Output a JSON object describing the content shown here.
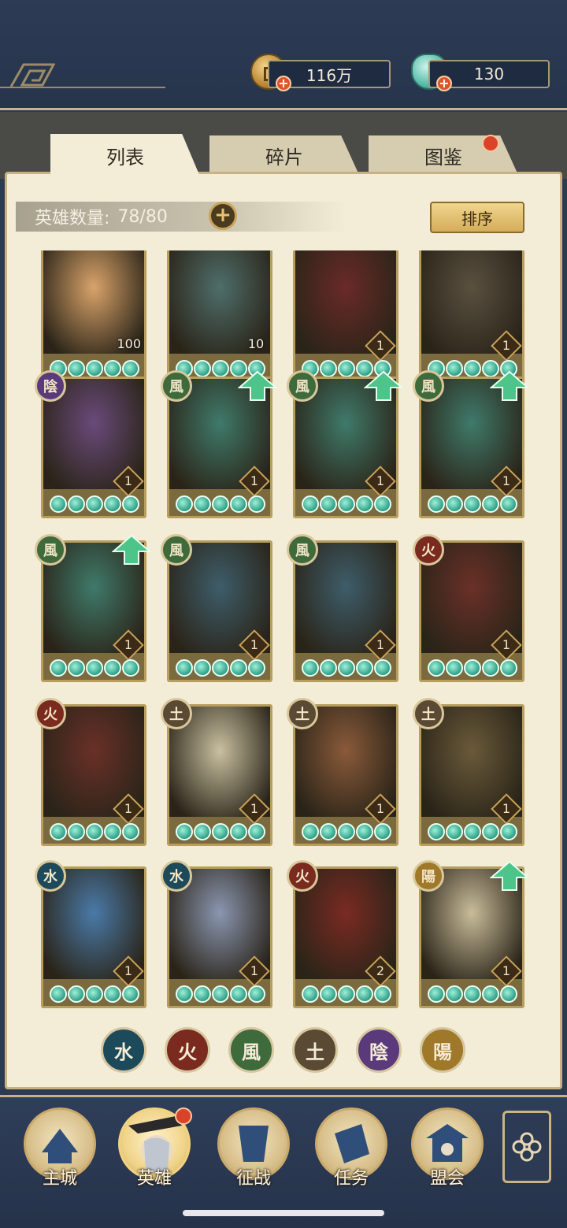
{
  "currency": {
    "coins": "116万",
    "gems": "130"
  },
  "tabs": [
    {
      "label": "列表"
    },
    {
      "label": "碎片"
    },
    {
      "label": "图鉴"
    }
  ],
  "hero_count": {
    "label": "英雄数量:",
    "value": "78/80"
  },
  "sort_label": "排序",
  "heroes": [
    {
      "level": "100",
      "element": "",
      "upgrade": false
    },
    {
      "level": "10",
      "element": "",
      "upgrade": false
    },
    {
      "level": "1",
      "element": "",
      "upgrade": false
    },
    {
      "level": "1",
      "element": "",
      "upgrade": false
    },
    {
      "level": "1",
      "element": "陰",
      "upgrade": false
    },
    {
      "level": "1",
      "element": "風",
      "upgrade": true
    },
    {
      "level": "1",
      "element": "風",
      "upgrade": true
    },
    {
      "level": "1",
      "element": "風",
      "upgrade": true
    },
    {
      "level": "1",
      "element": "風",
      "upgrade": true
    },
    {
      "level": "1",
      "element": "風",
      "upgrade": false
    },
    {
      "level": "1",
      "element": "風",
      "upgrade": false
    },
    {
      "level": "1",
      "element": "火",
      "upgrade": false
    },
    {
      "level": "1",
      "element": "火",
      "upgrade": false
    },
    {
      "level": "1",
      "element": "土",
      "upgrade": false
    },
    {
      "level": "1",
      "element": "土",
      "upgrade": false
    },
    {
      "level": "1",
      "element": "土",
      "upgrade": false
    },
    {
      "level": "1",
      "element": "水",
      "upgrade": false
    },
    {
      "level": "1",
      "element": "水",
      "upgrade": false
    },
    {
      "level": "2",
      "element": "火",
      "upgrade": false
    },
    {
      "level": "1",
      "element": "陽",
      "upgrade": true
    }
  ],
  "element_filters": [
    "水",
    "火",
    "風",
    "土",
    "陰",
    "陽"
  ],
  "nav": [
    {
      "label": "主城"
    },
    {
      "label": "英雄"
    },
    {
      "label": "征战"
    },
    {
      "label": "任务"
    },
    {
      "label": "盟会"
    }
  ],
  "colors": {
    "header": "#2d3b55",
    "paper": "#f3ecd6",
    "gold_border": "#c9b48a",
    "star": "#2e9f86",
    "notification": "#d9432a"
  }
}
